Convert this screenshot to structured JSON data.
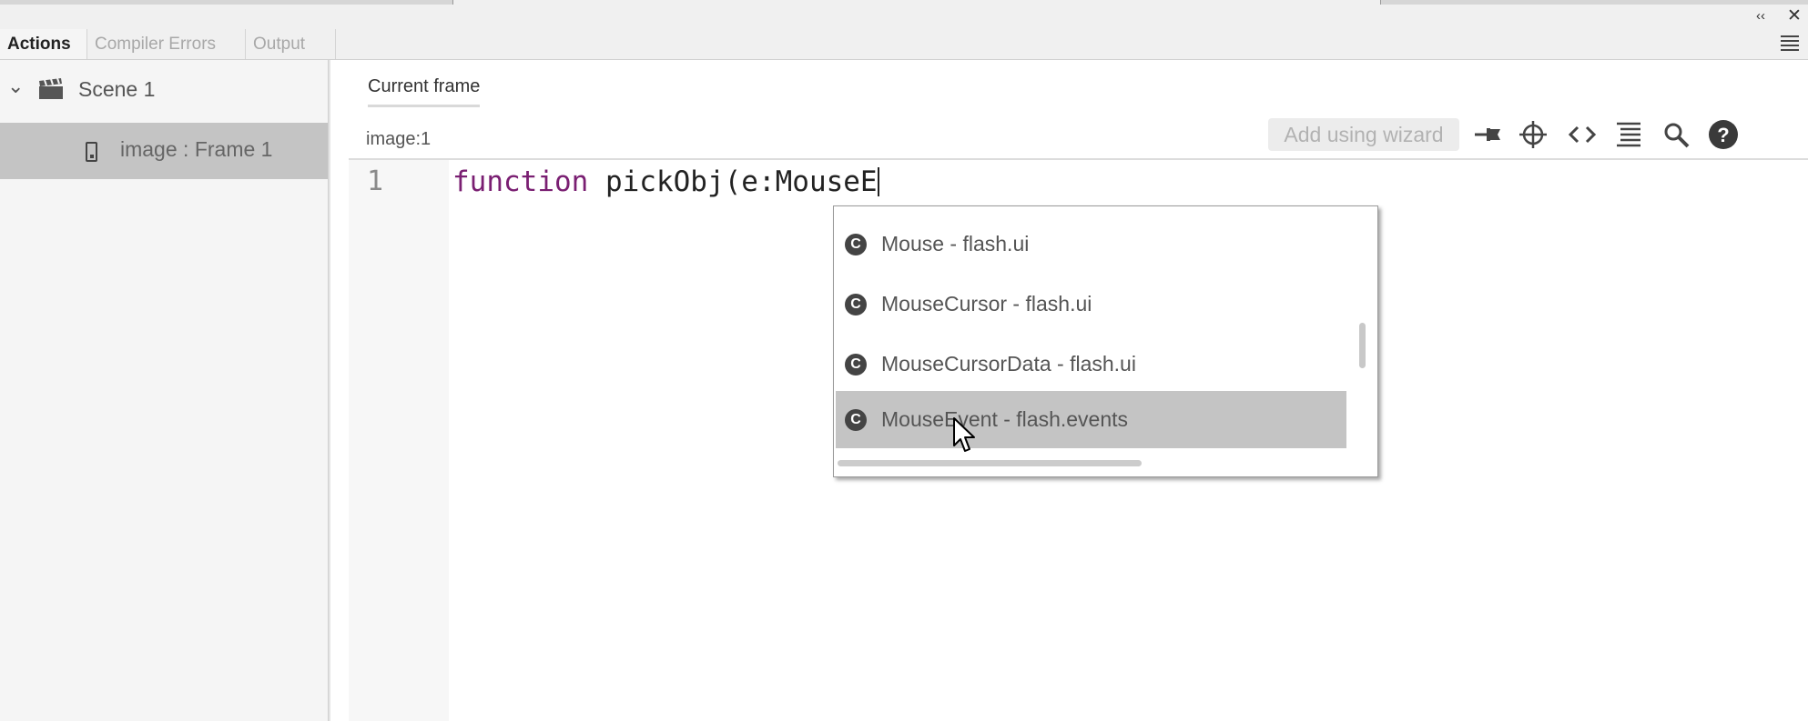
{
  "window": {
    "collapse_icon": "double-chevron-left-icon",
    "close_icon": "close-icon"
  },
  "tabs": [
    {
      "label": "Actions",
      "active": true
    },
    {
      "label": "Compiler Errors",
      "active": false
    },
    {
      "label": "Output",
      "active": false
    }
  ],
  "sidebar": {
    "scene_label": "Scene 1",
    "frame_label": "image : Frame 1"
  },
  "editor": {
    "current_frame_tab": "Current frame",
    "location_label": "image:1",
    "wizard_button": "Add using wizard",
    "line_number": "1",
    "code_keyword": "function",
    "code_rest": " pickObj(e:MouseE"
  },
  "autocomplete": {
    "items": [
      {
        "label": "Mouse - flash.ui",
        "icon": "C"
      },
      {
        "label": "MouseCursor - flash.ui",
        "icon": "C"
      },
      {
        "label": "MouseCursorData - flash.ui",
        "icon": "C"
      },
      {
        "label": "MouseEvent - flash.events",
        "icon": "C",
        "selected": true
      }
    ]
  },
  "colors": {
    "keyword": "#7a1f72",
    "selection": "#c4c4c4",
    "sidebar_bg": "#f5f5f5"
  }
}
